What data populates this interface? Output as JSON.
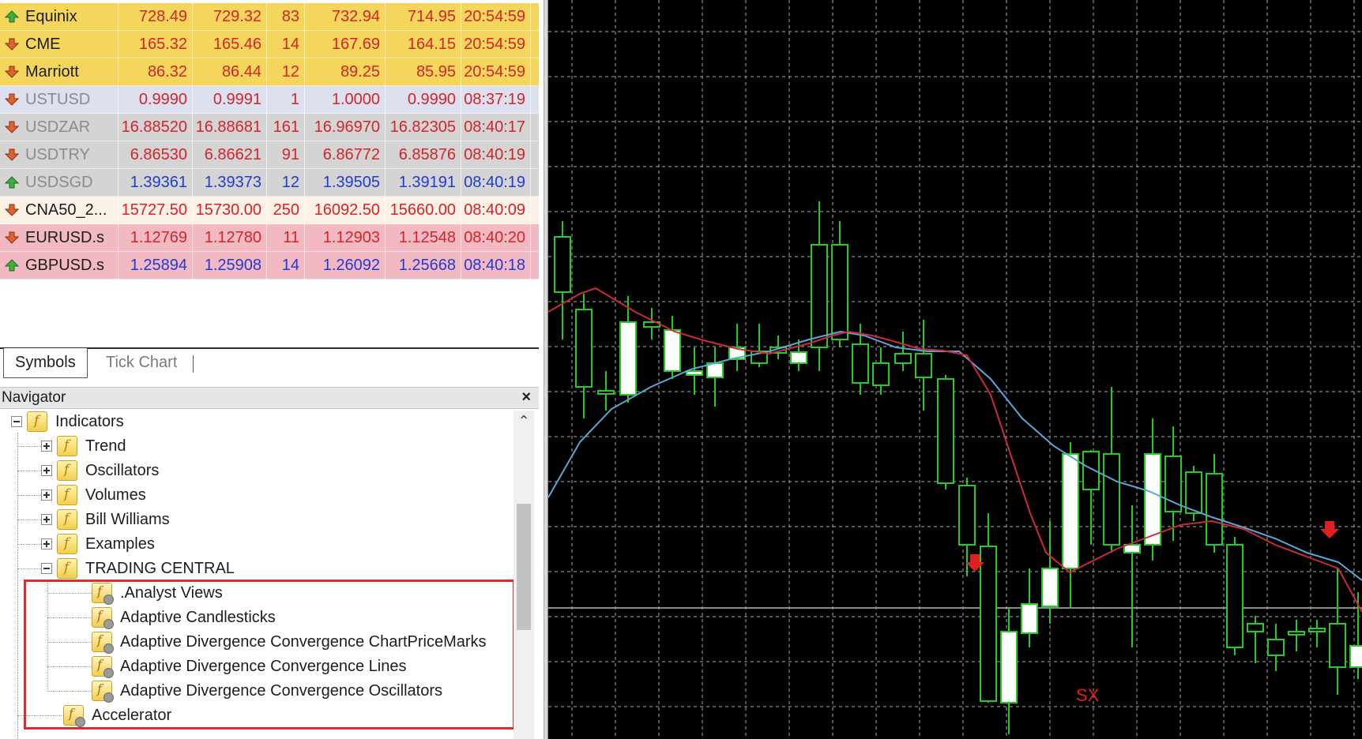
{
  "market_watch": {
    "rows": [
      {
        "symbol": "Equinix",
        "bid": "728.49",
        "ask": "729.32",
        "spread": "83",
        "high": "732.94",
        "low": "714.95",
        "time": "20:54:59",
        "direction": "up",
        "style": "yellow"
      },
      {
        "symbol": "CME",
        "bid": "165.32",
        "ask": "165.46",
        "spread": "14",
        "high": "167.69",
        "low": "164.15",
        "time": "20:54:59",
        "direction": "down",
        "style": "yellow"
      },
      {
        "symbol": "Marriott",
        "bid": "86.32",
        "ask": "86.44",
        "spread": "12",
        "high": "89.25",
        "low": "85.95",
        "time": "20:54:59",
        "direction": "down",
        "style": "yellow"
      },
      {
        "symbol": "USTUSD",
        "bid": "0.9990",
        "ask": "0.9991",
        "spread": "1",
        "high": "1.0000",
        "low": "0.9990",
        "time": "08:37:19",
        "direction": "down",
        "style": "grayblue"
      },
      {
        "symbol": "USDZAR",
        "bid": "16.88520",
        "ask": "16.88681",
        "spread": "161",
        "high": "16.96970",
        "low": "16.82305",
        "time": "08:40:17",
        "direction": "down",
        "style": "gray-red"
      },
      {
        "symbol": "USDTRY",
        "bid": "6.86530",
        "ask": "6.86621",
        "spread": "91",
        "high": "6.86772",
        "low": "6.85876",
        "time": "08:40:19",
        "direction": "down",
        "style": "gray-red"
      },
      {
        "symbol": "USDSGD",
        "bid": "1.39361",
        "ask": "1.39373",
        "spread": "12",
        "high": "1.39505",
        "low": "1.39191",
        "time": "08:40:19",
        "direction": "up",
        "style": "gray-blue"
      },
      {
        "symbol": "CNA50_2...",
        "bid": "15727.50",
        "ask": "15730.00",
        "spread": "250",
        "high": "16092.50",
        "low": "15660.00",
        "time": "08:40:09",
        "direction": "down",
        "style": "cream"
      },
      {
        "symbol": "EURUSD.s",
        "bid": "1.12769",
        "ask": "1.12780",
        "spread": "11",
        "high": "1.12903",
        "low": "1.12548",
        "time": "08:40:20",
        "direction": "down",
        "style": "pink-red"
      },
      {
        "symbol": "GBPUSD.s",
        "bid": "1.25894",
        "ask": "1.25908",
        "spread": "14",
        "high": "1.26092",
        "low": "1.25668",
        "time": "08:40:18",
        "direction": "up",
        "style": "pink-blue"
      }
    ]
  },
  "tabs": {
    "symbols": "Symbols",
    "tick_chart": "Tick Chart"
  },
  "navigator": {
    "title": "Navigator",
    "close": "×",
    "scroll_up": "⌃",
    "tree": {
      "root": "Indicators",
      "groups": [
        "Trend",
        "Oscillators",
        "Volumes",
        "Bill Williams",
        "Examples"
      ],
      "trading_central": "TRADING CENTRAL",
      "trading_central_items": [
        ".Analyst Views",
        "Adaptive Candlesticks",
        "Adaptive Divergence Convergence ChartPriceMarks",
        "Adaptive Divergence Convergence Lines",
        "Adaptive Divergence Convergence Oscillators"
      ],
      "last_item": "Accelerator"
    }
  },
  "chart": {
    "background": "#000000",
    "grid_color": "#8a8a8a",
    "bull_color": "#ffffff",
    "bear_color": "#000000",
    "wick_color": "#22cc22",
    "ma_fast_color": "#cc2a3a",
    "ma_slow_color": "#5aa6d6",
    "signal_color": "#e02020",
    "signal_label": "SX"
  },
  "colors": {
    "row_yellow": "#f5d65c",
    "row_gray": "#d4d4d4",
    "row_pink": "#f3b9c2",
    "highlight_box": "#d63030"
  }
}
